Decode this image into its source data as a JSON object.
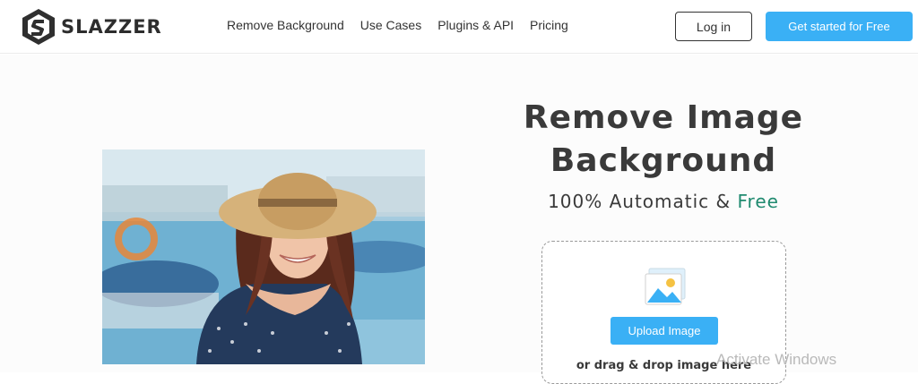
{
  "header": {
    "logo_text": "SLAZZER",
    "nav": [
      "Remove Background",
      "Use Cases",
      "Plugins & API",
      "Pricing"
    ],
    "login_label": "Log in",
    "cta_label": "Get started for Free"
  },
  "hero": {
    "title_line1": "Remove Image",
    "title_line2": "Background",
    "subtitle_main": "100% Automatic & ",
    "subtitle_accent": "Free",
    "upload_label": "Upload Image",
    "drag_text": "or drag & drop image here"
  },
  "overlay": {
    "watermark": "Activate Windows"
  },
  "colors": {
    "accent": "#3ab0f5",
    "free_text": "#1f8a6f",
    "text": "#3a3a3a"
  },
  "icons": [
    "slazzer-logo-icon",
    "image-icon"
  ]
}
